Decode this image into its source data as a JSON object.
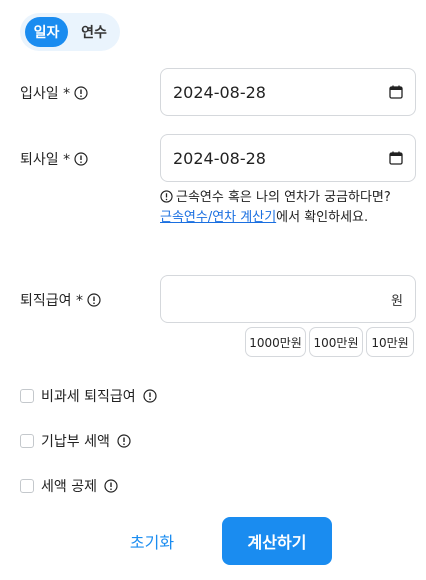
{
  "mode_toggle": {
    "days_label": "일자",
    "years_label": "연수",
    "active": "days"
  },
  "join_date": {
    "label": "입사일 *",
    "value": "2024-08-28"
  },
  "leave_date": {
    "label": "퇴사일 *",
    "value": "2024-08-28"
  },
  "hint": {
    "line_start": "근속연수 혹은 나의 연차가 궁금하다면? ",
    "link": "근속연수/연차 계산기",
    "line_end": "에서 확인하세요."
  },
  "severance": {
    "label": "퇴직급여 *",
    "value": "",
    "unit": "원"
  },
  "quick_amounts": [
    "1000만원",
    "100만원",
    "10만원"
  ],
  "options": {
    "nontaxable": "비과세 퇴직급여",
    "paid_tax": "기납부 세액",
    "tax_credit": "세액 공제"
  },
  "actions": {
    "reset": "초기화",
    "calculate": "계산하기"
  },
  "colors": {
    "accent": "#1a8cf0",
    "toggle_bg": "#eaf4fd",
    "link": "#1a6fe0",
    "border": "#d5d8dc"
  }
}
